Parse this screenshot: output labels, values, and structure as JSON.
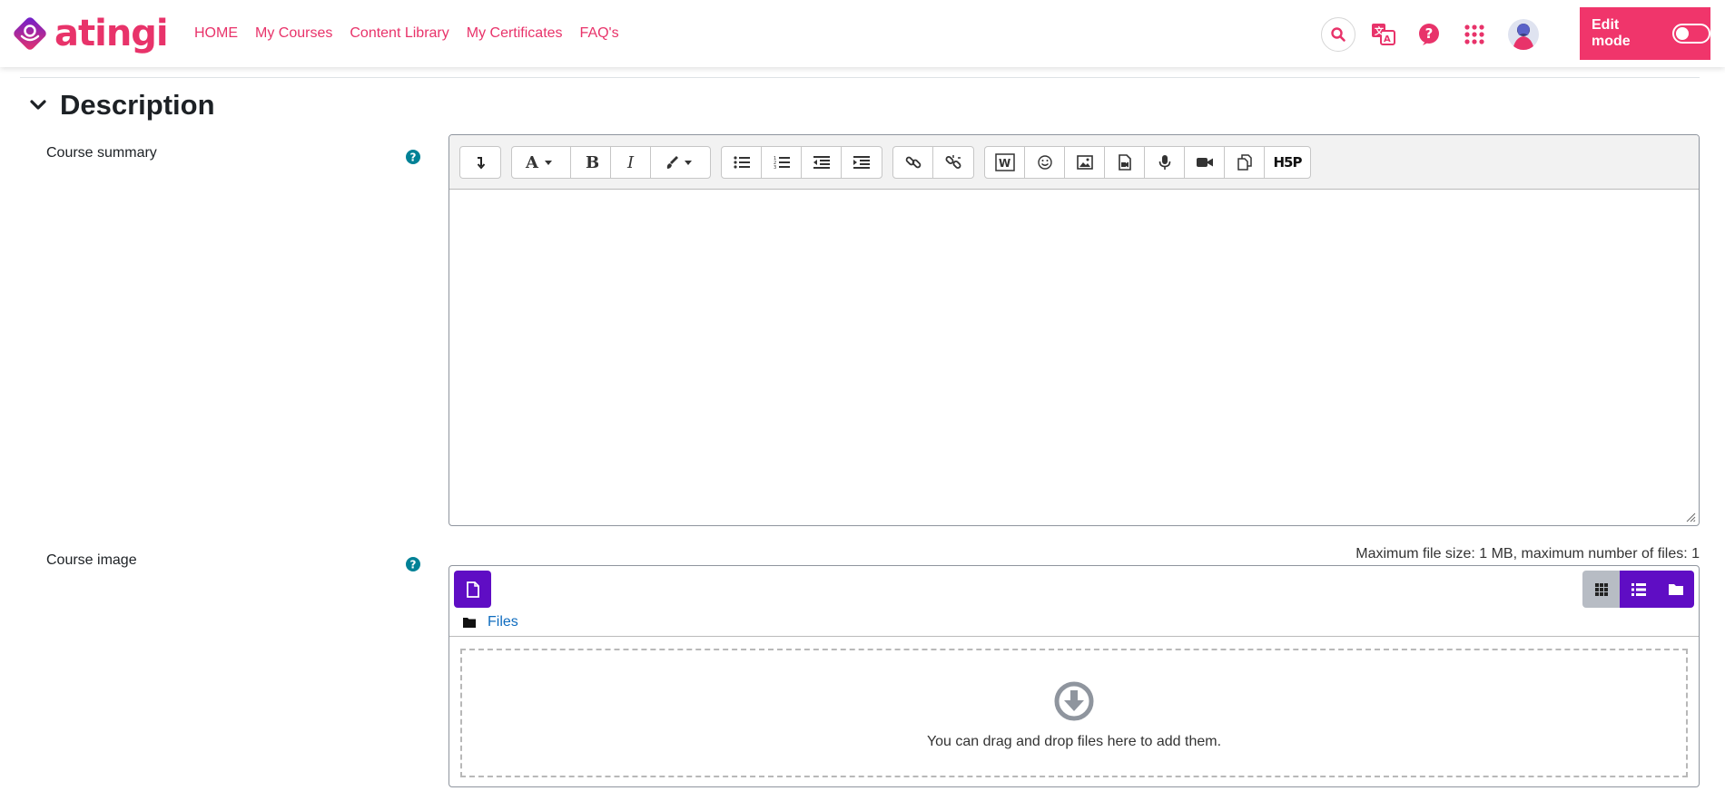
{
  "brand": {
    "name": "atingi",
    "color": "#e8336a"
  },
  "nav": {
    "links": [
      "HOME",
      "My Courses",
      "Content Library",
      "My Certificates",
      "FAQ's"
    ],
    "icons": [
      "search-icon",
      "language-icon",
      "help-icon",
      "apps-grid-icon"
    ],
    "edit_mode_label": "Edit mode",
    "edit_mode_on": false
  },
  "section": {
    "title": "Description",
    "expanded": true
  },
  "course_summary": {
    "label": "Course summary",
    "toolbar_groups": [
      [
        "show-more-icon"
      ],
      [
        "font-style-icon",
        "bold-icon",
        "italic-icon",
        "text-color-icon"
      ],
      [
        "unordered-list-icon",
        "ordered-list-icon",
        "outdent-icon",
        "indent-icon"
      ],
      [
        "link-icon",
        "unlink-icon"
      ],
      [
        "word-import-icon",
        "emoji-icon",
        "image-icon",
        "media-icon",
        "record-audio-icon",
        "record-video-icon",
        "manage-files-icon",
        "h5p-icon"
      ]
    ],
    "h5p_label": "H5P",
    "content": ""
  },
  "course_image": {
    "label": "Course image",
    "limits": "Maximum file size: 1 MB, maximum number of files: 1",
    "path_label": "Files",
    "drop_text": "You can drag and drop files here to add them.",
    "active_view": "icons"
  },
  "colors": {
    "accent": "#e8336a",
    "edit_bg": "#f0356b",
    "primary": "#5f0dc4",
    "help": "#008196",
    "link": "#0f6cbf"
  }
}
